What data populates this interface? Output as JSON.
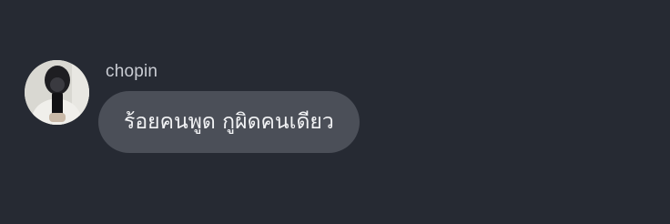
{
  "chat": {
    "messages": [
      {
        "sender": "chopin",
        "text": "ร้อยคนพูด กูผิดคนเดียว",
        "avatar": "user-avatar-photo"
      }
    ]
  },
  "colors": {
    "background": "#262a33",
    "bubble": "#4b4f58",
    "sender_name": "#c9ccd3",
    "message_text": "#f2f3f5"
  }
}
